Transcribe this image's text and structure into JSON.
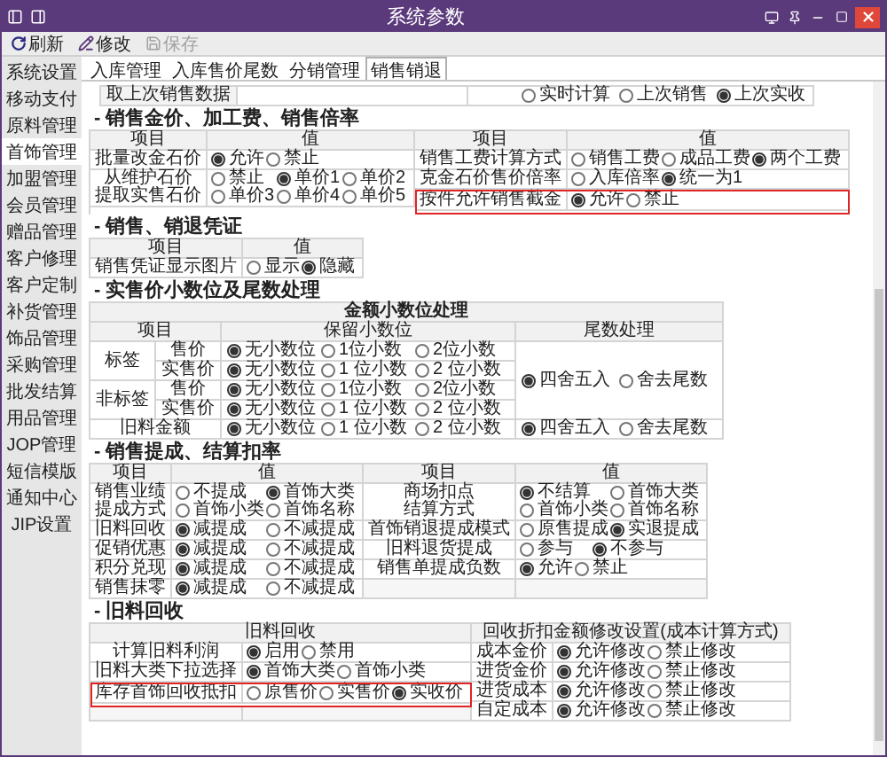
{
  "window": {
    "title": "系统参数"
  },
  "toolbar": [
    {
      "label": "刷新",
      "disabled": false
    },
    {
      "label": "修改",
      "disabled": false
    },
    {
      "label": "保存",
      "disabled": true
    }
  ],
  "sidebar": {
    "items": [
      {
        "label": "系统设置",
        "selected": false
      },
      {
        "label": "移动支付",
        "selected": false
      },
      {
        "label": "原料管理",
        "selected": false
      },
      {
        "label": "首饰管理",
        "selected": true
      },
      {
        "label": "加盟管理",
        "selected": false
      },
      {
        "label": "会员管理",
        "selected": false
      },
      {
        "label": "赠品管理",
        "selected": false
      },
      {
        "label": "客户修理",
        "selected": false
      },
      {
        "label": "客户定制",
        "selected": false
      },
      {
        "label": "补货管理",
        "selected": false
      },
      {
        "label": "饰品管理",
        "selected": false
      },
      {
        "label": "采购管理",
        "selected": false
      },
      {
        "label": "批发结算",
        "selected": false
      },
      {
        "label": "用品管理",
        "selected": false
      },
      {
        "label": "JOP管理",
        "selected": false
      },
      {
        "label": "短信模版",
        "selected": false
      },
      {
        "label": "通知中心",
        "selected": false
      },
      {
        "label": "JIP设置",
        "selected": false
      }
    ]
  },
  "tabs": [
    {
      "label": "入库管理",
      "selected": false
    },
    {
      "label": "入库售价尾数",
      "selected": false
    },
    {
      "label": "分销管理",
      "selected": false
    },
    {
      "label": "销售销退",
      "selected": true
    }
  ],
  "top_row": {
    "label": "取上次销售数据",
    "options": [
      {
        "text": "实时计算",
        "selected": false
      },
      {
        "text": "上次销售",
        "selected": false
      },
      {
        "text": "上次实收",
        "selected": true
      }
    ]
  },
  "sections": [
    {
      "title": "- 销售金价、加工费、销售倍率",
      "kind": "split",
      "halves": [
        {
          "headers": [
            "项目",
            "值"
          ],
          "rows": [
            {
              "label_lines": [
                "批量改金石价"
              ],
              "option_lines": [
                [
                  {
                    "text": "允许",
                    "selected": true
                  },
                  {
                    "text": "禁止",
                    "selected": false
                  }
                ]
              ],
              "highlighted": false
            },
            {
              "label_lines": [
                "从维护石价",
                "提取实售石价"
              ],
              "option_lines": [
                [
                  {
                    "text": "禁止",
                    "selected": false
                  },
                  {
                    "text": "单价1",
                    "selected": true
                  },
                  {
                    "text": "单价2",
                    "selected": false
                  }
                ],
                [
                  {
                    "text": "单价3",
                    "selected": false
                  },
                  {
                    "text": "单价4",
                    "selected": false
                  },
                  {
                    "text": "单价5",
                    "selected": false
                  }
                ]
              ],
              "highlighted": false
            }
          ]
        },
        {
          "headers": [
            "项目",
            "值"
          ],
          "rows": [
            {
              "label_lines": [
                "销售工费计算方式"
              ],
              "option_lines": [
                [
                  {
                    "text": "销售工费",
                    "selected": false
                  },
                  {
                    "text": "成品工费",
                    "selected": false
                  },
                  {
                    "text": "两个工费",
                    "selected": true
                  }
                ]
              ],
              "highlighted": false
            },
            {
              "label_lines": [
                "克金石价售价倍率"
              ],
              "option_lines": [
                [
                  {
                    "text": "入库倍率",
                    "selected": false
                  },
                  {
                    "text": "统一为1",
                    "selected": true
                  }
                ]
              ],
              "highlighted": false
            },
            {
              "label_lines": [
                "按件允许销售截金"
              ],
              "option_lines": [
                [
                  {
                    "text": "允许",
                    "selected": true
                  },
                  {
                    "text": "禁止",
                    "selected": false
                  }
                ]
              ],
              "highlighted": true
            }
          ]
        }
      ]
    },
    {
      "title": "- 销售、销退凭证",
      "kind": "split",
      "halves": [
        {
          "headers": [
            "项目",
            "值"
          ],
          "rows": [
            {
              "label_lines": [
                "销售凭证显示图片"
              ],
              "option_lines": [
                [
                  {
                    "text": "显示",
                    "selected": false
                  },
                  {
                    "text": "隐藏",
                    "selected": true
                  }
                ]
              ],
              "highlighted": false
            }
          ]
        }
      ]
    },
    {
      "title": "- 实售价小数位及尾数处理",
      "kind": "decimal",
      "caption": "金额小数位处理",
      "headers": [
        "项目",
        "保留小数位",
        "尾数处理"
      ],
      "groups": [
        {
          "label": "标签",
          "rows": [
            {
              "label": "售价",
              "options": [
                {
                  "text": "无小数位",
                  "selected": true
                },
                {
                  "text": "1位小数",
                  "selected": false
                },
                {
                  "text": "2位小数",
                  "selected": false
                }
              ]
            },
            {
              "label": "实售价",
              "options": [
                {
                  "text": "无小数位",
                  "selected": true
                },
                {
                  "text": "1 位小数",
                  "selected": false
                },
                {
                  "text": "2 位小数",
                  "selected": false
                }
              ]
            }
          ]
        },
        {
          "label": "非标签",
          "rows": [
            {
              "label": "售价",
              "options": [
                {
                  "text": "无小数位",
                  "selected": true
                },
                {
                  "text": "1位小数",
                  "selected": false
                },
                {
                  "text": "2位小数",
                  "selected": false
                }
              ]
            },
            {
              "label": "实售价",
              "options": [
                {
                  "text": "无小数位",
                  "selected": true
                },
                {
                  "text": "1 位小数",
                  "selected": false
                },
                {
                  "text": "2 位小数",
                  "selected": false
                }
              ]
            }
          ]
        }
      ],
      "group_rounding": [
        {
          "text": "四舍五入",
          "selected": true
        },
        {
          "text": "舍去尾数",
          "selected": false
        }
      ],
      "footer": {
        "label": "旧料金额",
        "options": [
          {
            "text": "无小数位",
            "selected": true
          },
          {
            "text": "1 位小数",
            "selected": false
          },
          {
            "text": "2 位小数",
            "selected": false
          }
        ],
        "rounding": [
          {
            "text": "四舍五入",
            "selected": true
          },
          {
            "text": "舍去尾数",
            "selected": false
          }
        ]
      }
    },
    {
      "title": "- 销售提成、结算扣率",
      "kind": "split",
      "halves": [
        {
          "headers": [
            "项目",
            "值"
          ],
          "rows": [
            {
              "label_lines": [
                "销售业绩",
                "提成方式"
              ],
              "option_lines": [
                [
                  {
                    "text": "不提成",
                    "selected": false
                  },
                  {
                    "text": "首饰大类",
                    "selected": true
                  }
                ],
                [
                  {
                    "text": "首饰小类",
                    "selected": false
                  },
                  {
                    "text": "首饰名称",
                    "selected": false
                  }
                ]
              ],
              "highlighted": false
            },
            {
              "label_lines": [
                "旧料回收"
              ],
              "option_lines": [
                [
                  {
                    "text": "减提成",
                    "selected": true
                  },
                  {
                    "text": "不减提成",
                    "selected": false
                  }
                ]
              ],
              "highlighted": false
            },
            {
              "label_lines": [
                "促销优惠"
              ],
              "option_lines": [
                [
                  {
                    "text": "减提成",
                    "selected": true
                  },
                  {
                    "text": "不减提成",
                    "selected": false
                  }
                ]
              ],
              "highlighted": false
            },
            {
              "label_lines": [
                "积分兑现"
              ],
              "option_lines": [
                [
                  {
                    "text": "减提成",
                    "selected": true
                  },
                  {
                    "text": "不减提成",
                    "selected": false
                  }
                ]
              ],
              "highlighted": false
            },
            {
              "label_lines": [
                "销售抹零"
              ],
              "option_lines": [
                [
                  {
                    "text": "减提成",
                    "selected": true
                  },
                  {
                    "text": "不减提成",
                    "selected": false
                  }
                ]
              ],
              "highlighted": false
            }
          ]
        },
        {
          "headers": [
            "项目",
            "值"
          ],
          "rows": [
            {
              "label_lines": [
                "商场扣点",
                "结算方式"
              ],
              "option_lines": [
                [
                  {
                    "text": "不结算",
                    "selected": true
                  },
                  {
                    "text": "首饰大类",
                    "selected": false
                  }
                ],
                [
                  {
                    "text": "首饰小类",
                    "selected": false
                  },
                  {
                    "text": "首饰名称",
                    "selected": false
                  }
                ]
              ],
              "highlighted": false
            },
            {
              "label_lines": [
                "首饰销退提成模式"
              ],
              "option_lines": [
                [
                  {
                    "text": "原售提成",
                    "selected": false
                  },
                  {
                    "text": "实退提成",
                    "selected": true
                  }
                ]
              ],
              "highlighted": false
            },
            {
              "label_lines": [
                "旧料退货提成"
              ],
              "option_lines": [
                [
                  {
                    "text": "参与",
                    "selected": false
                  },
                  {
                    "text": "不参与",
                    "selected": true
                  }
                ]
              ],
              "highlighted": false
            },
            {
              "label_lines": [
                "销售单提成负数"
              ],
              "option_lines": [
                [
                  {
                    "text": "允许",
                    "selected": true
                  },
                  {
                    "text": "禁止",
                    "selected": false
                  }
                ]
              ],
              "highlighted": false
            }
          ]
        }
      ]
    },
    {
      "title": "- 旧料回收",
      "kind": "split",
      "halves": [
        {
          "headers": [
            "旧料回收"
          ],
          "rows": [
            {
              "label_lines": [
                "计算旧料利润"
              ],
              "option_lines": [
                [
                  {
                    "text": "启用",
                    "selected": true
                  },
                  {
                    "text": "禁用",
                    "selected": false
                  }
                ]
              ],
              "highlighted": false
            },
            {
              "label_lines": [
                "旧料大类下拉选择"
              ],
              "option_lines": [
                [
                  {
                    "text": "首饰大类",
                    "selected": true
                  },
                  {
                    "text": "首饰小类",
                    "selected": false
                  }
                ]
              ],
              "highlighted": false
            },
            {
              "label_lines": [
                "库存首饰回收抵扣"
              ],
              "option_lines": [
                [
                  {
                    "text": "原售价",
                    "selected": false
                  },
                  {
                    "text": "实售价",
                    "selected": false
                  },
                  {
                    "text": "实收价",
                    "selected": true
                  }
                ]
              ],
              "highlighted": true
            }
          ]
        },
        {
          "headers": [
            "回收折扣金额修改设置(成本计算方式)"
          ],
          "rows": [
            {
              "label_lines": [
                "成本金价"
              ],
              "option_lines": [
                [
                  {
                    "text": "允许修改",
                    "selected": true
                  },
                  {
                    "text": "禁止修改",
                    "selected": false
                  }
                ]
              ],
              "highlighted": false
            },
            {
              "label_lines": [
                "进货金价"
              ],
              "option_lines": [
                [
                  {
                    "text": "允许修改",
                    "selected": true
                  },
                  {
                    "text": "禁止修改",
                    "selected": false
                  }
                ]
              ],
              "highlighted": false
            },
            {
              "label_lines": [
                "进货成本"
              ],
              "option_lines": [
                [
                  {
                    "text": "允许修改",
                    "selected": true
                  },
                  {
                    "text": "禁止修改",
                    "selected": false
                  }
                ]
              ],
              "highlighted": false
            },
            {
              "label_lines": [
                "自定成本"
              ],
              "option_lines": [
                [
                  {
                    "text": "允许修改",
                    "selected": true
                  },
                  {
                    "text": "禁止修改",
                    "selected": false
                  }
                ]
              ],
              "highlighted": false
            }
          ]
        }
      ]
    }
  ]
}
